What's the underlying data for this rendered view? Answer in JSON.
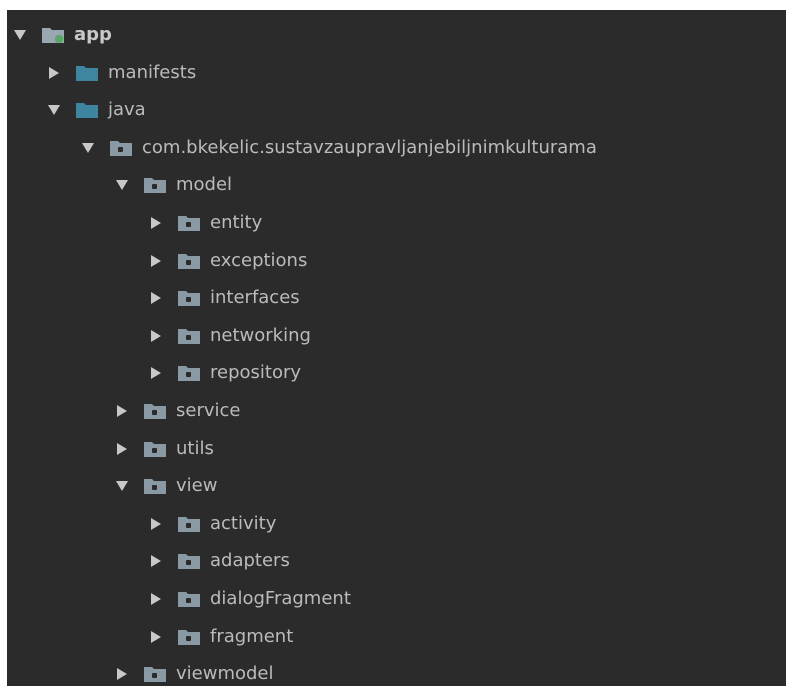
{
  "tree": [
    {
      "label": "app",
      "level": 0,
      "expanded": true,
      "icon": "module-folder-icon"
    },
    {
      "label": "manifests",
      "level": 1,
      "expanded": false,
      "icon": "source-folder-icon"
    },
    {
      "label": "java",
      "level": 1,
      "expanded": true,
      "icon": "source-folder-icon"
    },
    {
      "label": "com.bkekelic.sustavzaupravljanjebiljnimkulturama",
      "level": 2,
      "expanded": true,
      "icon": "package-folder-icon"
    },
    {
      "label": "model",
      "level": 3,
      "expanded": true,
      "icon": "package-folder-icon"
    },
    {
      "label": "entity",
      "level": 4,
      "expanded": false,
      "icon": "package-folder-icon"
    },
    {
      "label": "exceptions",
      "level": 4,
      "expanded": false,
      "icon": "package-folder-icon"
    },
    {
      "label": "interfaces",
      "level": 4,
      "expanded": false,
      "icon": "package-folder-icon"
    },
    {
      "label": "networking",
      "level": 4,
      "expanded": false,
      "icon": "package-folder-icon"
    },
    {
      "label": "repository",
      "level": 4,
      "expanded": false,
      "icon": "package-folder-icon"
    },
    {
      "label": "service",
      "level": 3,
      "expanded": false,
      "icon": "package-folder-icon"
    },
    {
      "label": "utils",
      "level": 3,
      "expanded": false,
      "icon": "package-folder-icon"
    },
    {
      "label": "view",
      "level": 3,
      "expanded": true,
      "icon": "package-folder-icon"
    },
    {
      "label": "activity",
      "level": 4,
      "expanded": false,
      "icon": "package-folder-icon"
    },
    {
      "label": "adapters",
      "level": 4,
      "expanded": false,
      "icon": "package-folder-icon"
    },
    {
      "label": "dialogFragment",
      "level": 4,
      "expanded": false,
      "icon": "package-folder-icon"
    },
    {
      "label": "fragment",
      "level": 4,
      "expanded": false,
      "icon": "package-folder-icon"
    },
    {
      "label": "viewmodel",
      "level": 3,
      "expanded": false,
      "icon": "package-folder-icon"
    }
  ],
  "colors": {
    "background": "#2b2b2b",
    "text": "#bbbbbb",
    "arrow": "#c8c8c8",
    "source_folder": "#3e86a0",
    "package_folder": "#8a9aa5",
    "module_folder": "#9aa7b0",
    "module_badge": "#59a869"
  }
}
